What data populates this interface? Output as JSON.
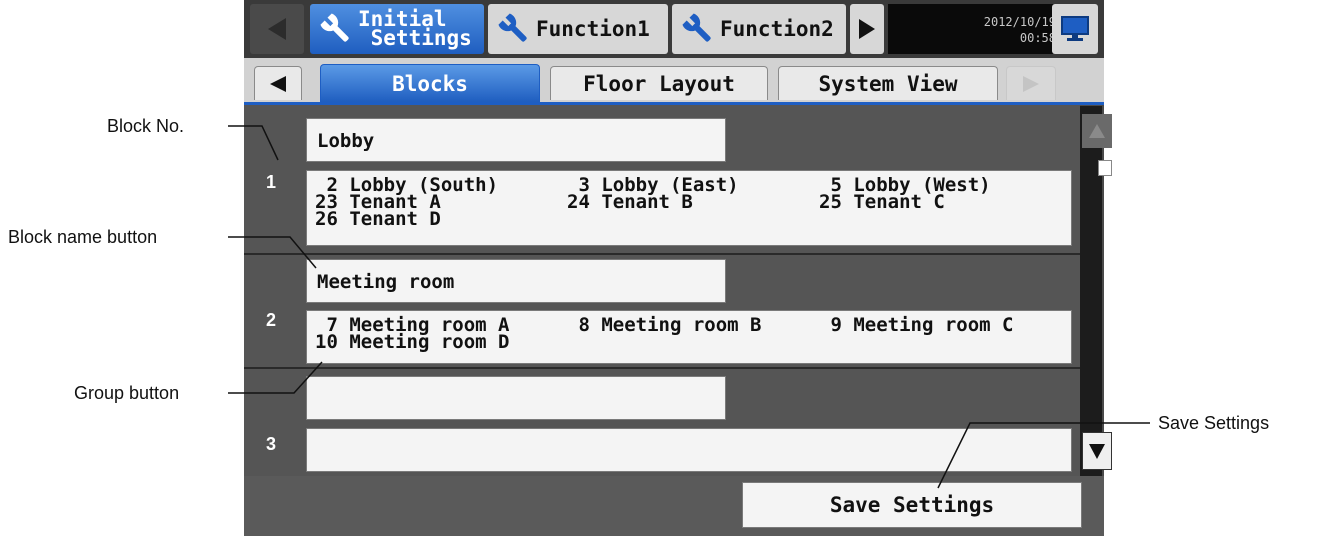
{
  "top_bar": {
    "tabs": [
      {
        "label": "Initial\n Settings",
        "selected": true
      },
      {
        "label": "Function1",
        "selected": false
      },
      {
        "label": "Function2",
        "selected": false
      }
    ],
    "clock_date": "2012/10/19",
    "clock_time": "00:58"
  },
  "sub_tabs": [
    {
      "label": "Blocks",
      "selected": true
    },
    {
      "label": "Floor Layout",
      "selected": false
    },
    {
      "label": "System View",
      "selected": false
    }
  ],
  "blocks": [
    {
      "number": "1",
      "name": "Lobby",
      "groups": [
        [
          " 2 Lobby (South)",
          " 3 Lobby (East)",
          " 5 Lobby (West)"
        ],
        [
          "23 Tenant A",
          "24 Tenant B",
          "25 Tenant C"
        ],
        [
          "26 Tenant D"
        ]
      ]
    },
    {
      "number": "2",
      "name": "Meeting room",
      "groups": [
        [
          " 7 Meeting room A",
          " 8 Meeting room B",
          " 9 Meeting room C"
        ],
        [
          "10 Meeting room D"
        ]
      ]
    },
    {
      "number": "3",
      "name": "",
      "groups": []
    }
  ],
  "save_button": "Save Settings",
  "annotations": {
    "block_no": "Block No.",
    "block_name_button": "Block name button",
    "group_button": "Group button",
    "save_settings": "Save Settings"
  },
  "colors": {
    "accent": "#1f5ec0",
    "panel": "#4a4a4a"
  },
  "icons": [
    "left-arrow-icon",
    "wrench-icon",
    "right-arrow-icon",
    "monitor-icon",
    "scroll-up-icon",
    "scroll-down-icon"
  ]
}
